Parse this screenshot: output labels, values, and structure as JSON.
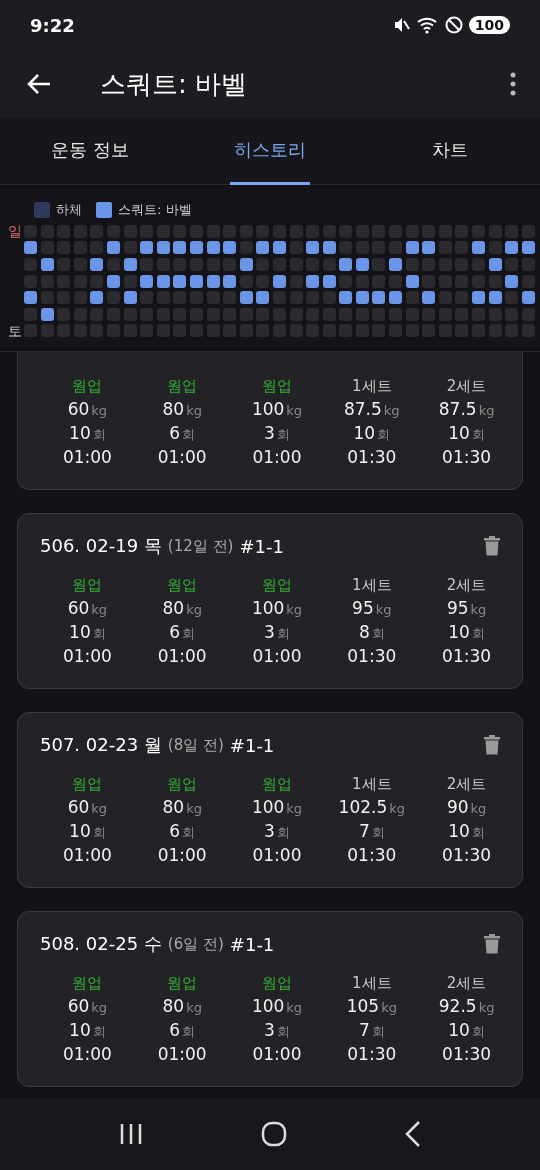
{
  "status_bar": {
    "time": "9:22",
    "battery": "100"
  },
  "app_bar": {
    "title": "스쿼트: 바벨"
  },
  "tabs": [
    {
      "label": "운동 정보",
      "selected": false
    },
    {
      "label": "히스토리",
      "selected": true
    },
    {
      "label": "차트",
      "selected": false
    }
  ],
  "heatmap": {
    "legend": [
      {
        "label": "하체",
        "color": "#2d3a5e"
      },
      {
        "label": "스쿼트: 바벨",
        "color": "#6b95e8"
      }
    ],
    "rows": [
      {
        "label": "일",
        "cells": [
          false,
          false,
          false,
          false,
          false,
          false,
          false,
          false,
          false,
          false,
          false,
          false,
          false,
          false,
          false,
          false,
          false,
          false,
          false,
          false,
          false,
          false,
          false,
          false,
          false,
          false,
          false,
          false,
          false,
          false,
          false
        ]
      },
      {
        "cells": [
          true,
          false,
          false,
          false,
          false,
          true,
          false,
          true,
          true,
          true,
          true,
          true,
          true,
          false,
          true,
          true,
          false,
          true,
          true,
          false,
          false,
          false,
          false,
          true,
          true,
          false,
          false,
          true,
          false,
          true,
          true
        ]
      },
      {
        "cells": [
          false,
          true,
          false,
          false,
          true,
          false,
          true,
          false,
          false,
          false,
          false,
          false,
          false,
          true,
          false,
          false,
          false,
          false,
          false,
          true,
          true,
          false,
          true,
          false,
          false,
          false,
          false,
          false,
          true,
          false,
          false
        ]
      },
      {
        "cells": [
          false,
          false,
          false,
          false,
          false,
          true,
          false,
          true,
          true,
          true,
          true,
          true,
          true,
          false,
          false,
          true,
          false,
          true,
          true,
          false,
          false,
          false,
          false,
          true,
          false,
          false,
          false,
          false,
          false,
          true,
          false
        ]
      },
      {
        "cells": [
          true,
          false,
          false,
          false,
          true,
          false,
          true,
          false,
          false,
          false,
          false,
          false,
          false,
          true,
          true,
          false,
          false,
          false,
          false,
          true,
          true,
          true,
          true,
          false,
          true,
          false,
          false,
          true,
          true,
          false,
          true
        ]
      },
      {
        "cells": [
          false,
          true,
          false,
          false,
          false,
          false,
          false,
          false,
          false,
          false,
          false,
          false,
          false,
          false,
          false,
          false,
          false,
          false,
          false,
          false,
          false,
          false,
          false,
          false,
          false,
          false,
          false,
          false,
          false,
          false,
          false
        ]
      },
      {
        "label": "토",
        "cells": [
          false,
          false,
          false,
          false,
          false,
          false,
          false,
          false,
          false,
          false,
          false,
          false,
          false,
          false,
          false,
          false,
          false,
          false,
          false,
          false,
          false,
          false,
          false,
          false,
          false,
          false,
          false,
          false,
          false,
          false,
          false
        ]
      }
    ]
  },
  "history": [
    {
      "sets": [
        {
          "kind": "warmup",
          "label": "웜업",
          "weight": "60",
          "weight_unit": "kg",
          "reps": "10",
          "reps_unit": "회",
          "time": "01:00"
        },
        {
          "kind": "warmup",
          "label": "웜업",
          "weight": "80",
          "weight_unit": "kg",
          "reps": "6",
          "reps_unit": "회",
          "time": "01:00"
        },
        {
          "kind": "warmup",
          "label": "웜업",
          "weight": "100",
          "weight_unit": "kg",
          "reps": "3",
          "reps_unit": "회",
          "time": "01:00"
        },
        {
          "kind": "set",
          "label": "1세트",
          "weight": "87.5",
          "weight_unit": "kg",
          "reps": "10",
          "reps_unit": "회",
          "time": "01:30"
        },
        {
          "kind": "set",
          "label": "2세트",
          "weight": "87.5",
          "weight_unit": "kg",
          "reps": "10",
          "reps_unit": "회",
          "time": "01:30"
        }
      ]
    },
    {
      "title": "506. 02-19 목",
      "ago": "(12일 전)",
      "code": "#1-1",
      "sets": [
        {
          "kind": "warmup",
          "label": "웜업",
          "weight": "60",
          "weight_unit": "kg",
          "reps": "10",
          "reps_unit": "회",
          "time": "01:00"
        },
        {
          "kind": "warmup",
          "label": "웜업",
          "weight": "80",
          "weight_unit": "kg",
          "reps": "6",
          "reps_unit": "회",
          "time": "01:00"
        },
        {
          "kind": "warmup",
          "label": "웜업",
          "weight": "100",
          "weight_unit": "kg",
          "reps": "3",
          "reps_unit": "회",
          "time": "01:00"
        },
        {
          "kind": "set",
          "label": "1세트",
          "weight": "95",
          "weight_unit": "kg",
          "reps": "8",
          "reps_unit": "회",
          "time": "01:30"
        },
        {
          "kind": "set",
          "label": "2세트",
          "weight": "95",
          "weight_unit": "kg",
          "reps": "10",
          "reps_unit": "회",
          "time": "01:30"
        }
      ]
    },
    {
      "title": "507. 02-23 월",
      "ago": "(8일 전)",
      "code": "#1-1",
      "sets": [
        {
          "kind": "warmup",
          "label": "웜업",
          "weight": "60",
          "weight_unit": "kg",
          "reps": "10",
          "reps_unit": "회",
          "time": "01:00"
        },
        {
          "kind": "warmup",
          "label": "웜업",
          "weight": "80",
          "weight_unit": "kg",
          "reps": "6",
          "reps_unit": "회",
          "time": "01:00"
        },
        {
          "kind": "warmup",
          "label": "웜업",
          "weight": "100",
          "weight_unit": "kg",
          "reps": "3",
          "reps_unit": "회",
          "time": "01:00"
        },
        {
          "kind": "set",
          "label": "1세트",
          "weight": "102.5",
          "weight_unit": "kg",
          "reps": "7",
          "reps_unit": "회",
          "time": "01:30"
        },
        {
          "kind": "set",
          "label": "2세트",
          "weight": "90",
          "weight_unit": "kg",
          "reps": "10",
          "reps_unit": "회",
          "time": "01:30"
        }
      ]
    },
    {
      "title": "508. 02-25 수",
      "ago": "(6일 전)",
      "code": "#1-1",
      "sets": [
        {
          "kind": "warmup",
          "label": "웜업",
          "weight": "60",
          "weight_unit": "kg",
          "reps": "10",
          "reps_unit": "회",
          "time": "01:00"
        },
        {
          "kind": "warmup",
          "label": "웜업",
          "weight": "80",
          "weight_unit": "kg",
          "reps": "6",
          "reps_unit": "회",
          "time": "01:00"
        },
        {
          "kind": "warmup",
          "label": "웜업",
          "weight": "100",
          "weight_unit": "kg",
          "reps": "3",
          "reps_unit": "회",
          "time": "01:00"
        },
        {
          "kind": "set",
          "label": "1세트",
          "weight": "105",
          "weight_unit": "kg",
          "reps": "7",
          "reps_unit": "회",
          "time": "01:30"
        },
        {
          "kind": "set",
          "label": "2세트",
          "weight": "92.5",
          "weight_unit": "kg",
          "reps": "10",
          "reps_unit": "회",
          "time": "01:30"
        }
      ]
    }
  ]
}
